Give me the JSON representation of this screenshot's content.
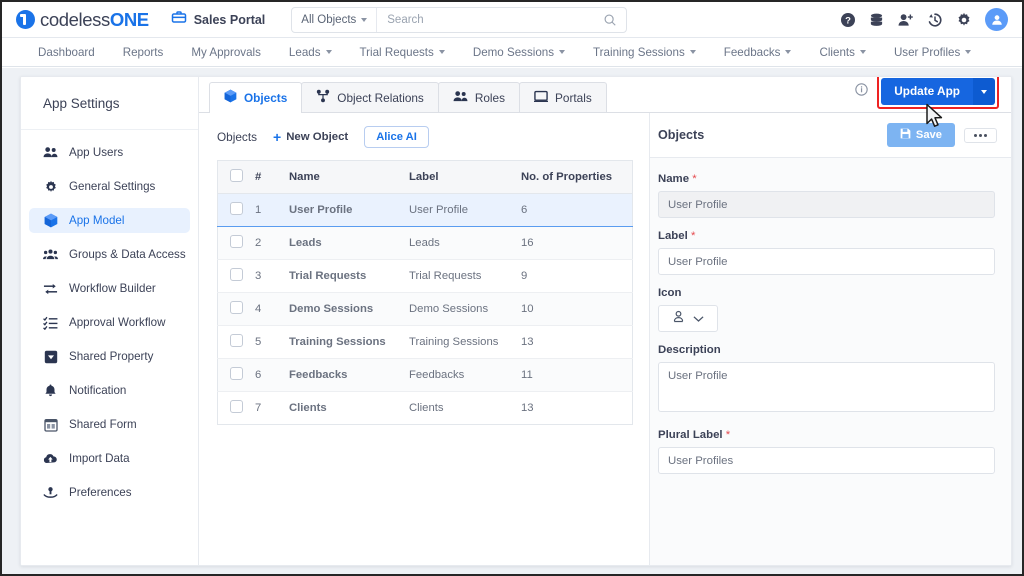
{
  "topbar": {
    "logo_text_a": "codeless",
    "logo_text_b": "ONE",
    "portal_name": "Sales Portal",
    "scope_label": "All Objects",
    "search_placeholder": "Search",
    "search_value": "",
    "icons": [
      "help-icon",
      "database-icon",
      "add-user-icon",
      "history-icon",
      "gear-icon",
      "avatar"
    ]
  },
  "nav": {
    "items": [
      {
        "label": "Dashboard",
        "caret": false
      },
      {
        "label": "Reports",
        "caret": false
      },
      {
        "label": "My Approvals",
        "caret": false
      },
      {
        "label": "Leads",
        "caret": true
      },
      {
        "label": "Trial Requests",
        "caret": true
      },
      {
        "label": "Demo Sessions",
        "caret": true
      },
      {
        "label": "Training Sessions",
        "caret": true
      },
      {
        "label": "Feedbacks",
        "caret": true
      },
      {
        "label": "Clients",
        "caret": true
      },
      {
        "label": "User Profiles",
        "caret": true
      }
    ]
  },
  "sidebar": {
    "title": "App Settings",
    "items": [
      {
        "label": "App Users",
        "icon": "users-icon",
        "active": false
      },
      {
        "label": "General Settings",
        "icon": "gear-icon",
        "active": false
      },
      {
        "label": "App Model",
        "icon": "cube-icon",
        "active": true
      },
      {
        "label": "Groups & Data Access",
        "icon": "group-icon",
        "active": false
      },
      {
        "label": "Workflow Builder",
        "icon": "arrows-icon",
        "active": false
      },
      {
        "label": "Approval Workflow",
        "icon": "checklist-icon",
        "active": false
      },
      {
        "label": "Shared Property",
        "icon": "shared-property-icon",
        "active": false
      },
      {
        "label": "Notification",
        "icon": "bell-icon",
        "active": false
      },
      {
        "label": "Shared Form",
        "icon": "form-icon",
        "active": false
      },
      {
        "label": "Import Data",
        "icon": "cloud-upload-icon",
        "active": false
      },
      {
        "label": "Preferences",
        "icon": "preferences-icon",
        "active": false
      }
    ]
  },
  "main": {
    "tabs": [
      {
        "label": "Objects",
        "icon": "cube-icon",
        "active": true
      },
      {
        "label": "Object Relations",
        "icon": "relations-icon",
        "active": false
      },
      {
        "label": "Roles",
        "icon": "people-icon",
        "active": false
      },
      {
        "label": "Portals",
        "icon": "portal-icon",
        "active": false
      }
    ],
    "info_icon": "info-icon",
    "update_button": {
      "label": "Update App",
      "dropdown_icon": "chevron-down-icon",
      "highlight_color": "#ee2222"
    },
    "toolbar": {
      "section_label": "Objects",
      "new_object_label": "New Object",
      "alice_ai_label": "Alice AI"
    },
    "table": {
      "headers": [
        "",
        "#",
        "Name",
        "Label",
        "No. of Properties"
      ],
      "rows": [
        {
          "num": "1",
          "name": "User Profile",
          "label": "User Profile",
          "props": "6",
          "selected": true
        },
        {
          "num": "2",
          "name": "Leads",
          "label": "Leads",
          "props": "16",
          "selected": false
        },
        {
          "num": "3",
          "name": "Trial Requests",
          "label": "Trial Requests",
          "props": "9",
          "selected": false
        },
        {
          "num": "4",
          "name": "Demo Sessions",
          "label": "Demo Sessions",
          "props": "10",
          "selected": false
        },
        {
          "num": "5",
          "name": "Training Sessions",
          "label": "Training Sessions",
          "props": "13",
          "selected": false
        },
        {
          "num": "6",
          "name": "Feedbacks",
          "label": "Feedbacks",
          "props": "11",
          "selected": false
        },
        {
          "num": "7",
          "name": "Clients",
          "label": "Clients",
          "props": "13",
          "selected": false
        }
      ]
    }
  },
  "details": {
    "title": "Objects",
    "save_label": "Save",
    "more_label": "more-options",
    "fields": {
      "name_label": "Name",
      "name_value": "User Profile",
      "label_label": "Label",
      "label_value": "User Profile",
      "icon_label": "Icon",
      "icon_value": "person-icon",
      "description_label": "Description",
      "description_value": "User Profile",
      "plural_label_label": "Plural Label",
      "plural_label_value": "User Profiles"
    }
  },
  "theme": {
    "accent": "#1a73e8",
    "highlight": "#ee2222",
    "link": "#1a73e8"
  }
}
